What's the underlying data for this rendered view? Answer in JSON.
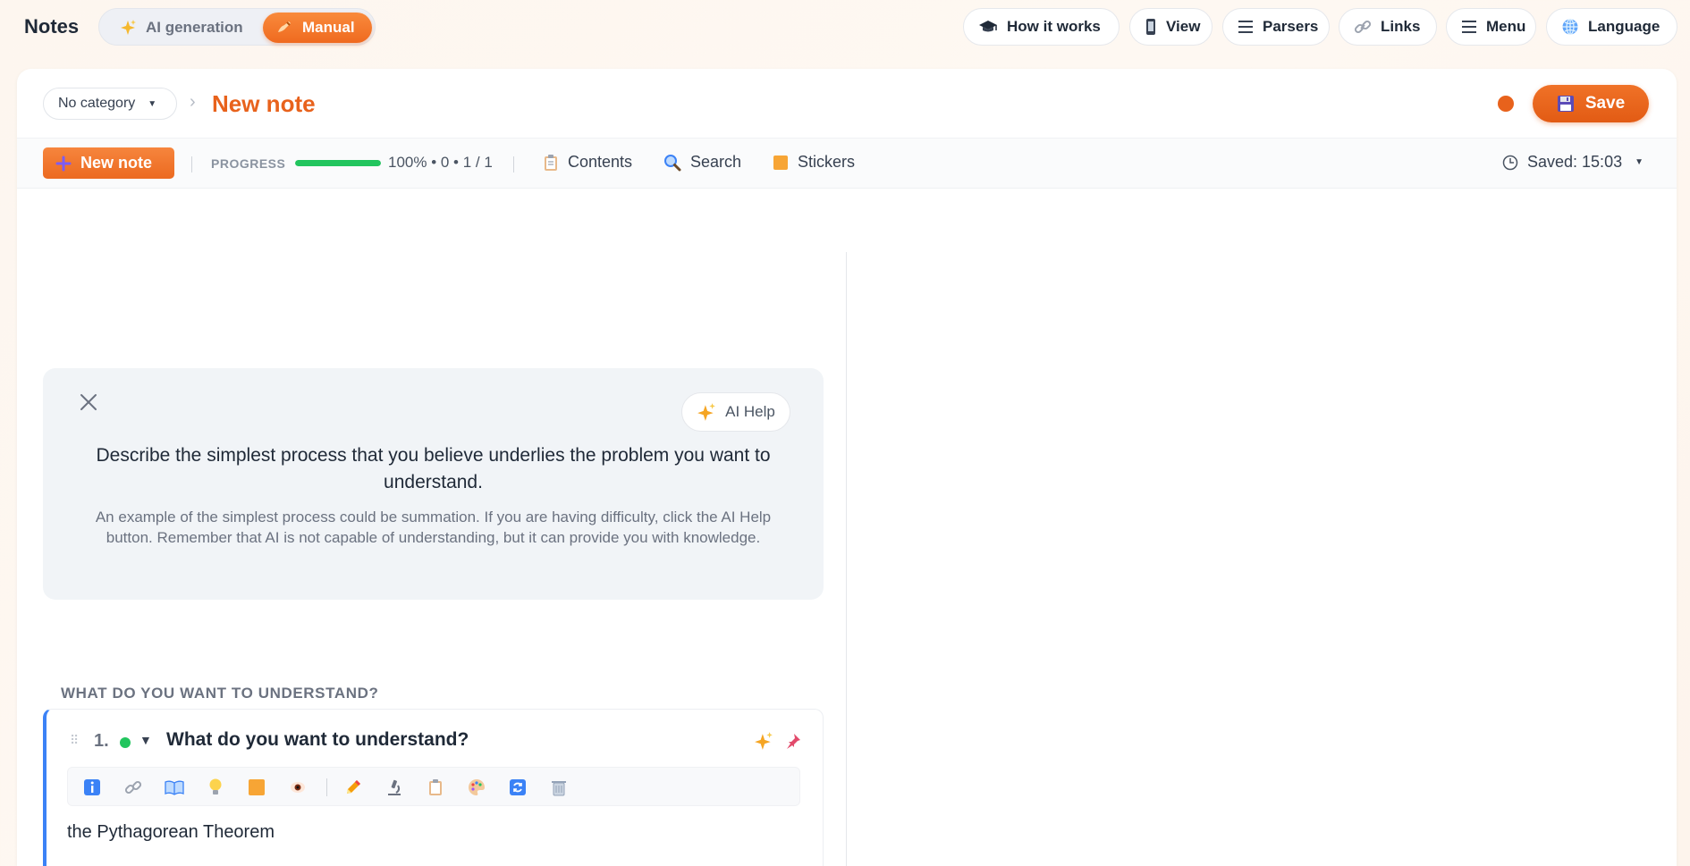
{
  "app": {
    "title": "Notes"
  },
  "mode_switch": {
    "ai_label": "AI generation",
    "manual_label": "Manual",
    "active": "Manual"
  },
  "top_nav": [
    {
      "label": "How it works",
      "icon": "graduation-cap-icon"
    },
    {
      "label": "View",
      "icon": "phone-icon"
    },
    {
      "label": "Parsers",
      "icon": "list-icon"
    },
    {
      "label": "Links",
      "icon": "link-icon"
    },
    {
      "label": "Menu",
      "icon": "hamburger-icon"
    },
    {
      "label": "Language",
      "icon": "globe-icon"
    }
  ],
  "header": {
    "category": "No category",
    "note_title": "New note",
    "save_label": "Save",
    "status_color": "#e8621c"
  },
  "toolbar": {
    "new_note_label": "New note",
    "progress_label": "PROGRESS",
    "progress_value": 1.0,
    "progress_text": "100% • 0 • 1 / 1",
    "contents_label": "Contents",
    "search_label": "Search",
    "stickers_label": "Stickers",
    "saved_label": "Saved: 15:03"
  },
  "hint": {
    "ai_help_label": "AI Help",
    "title": "Describe the simplest process that you believe underlies the problem you want to understand.",
    "body": "An example of the simplest process could be summation. If you are having difficulty, click the AI Help button. Remember that AI is not capable of understanding, but it can provide you with knowledge."
  },
  "section": {
    "label": "WHAT DO YOU WANT TO UNDERSTAND?"
  },
  "question": {
    "number": "1.",
    "title": "What do you want to understand?",
    "text": "the Pythagorean Theorem",
    "status_color": "#22c55e",
    "accent_color": "#3b82f6"
  },
  "colors": {
    "brand": "#e8621c",
    "progress": "#22c55e"
  }
}
